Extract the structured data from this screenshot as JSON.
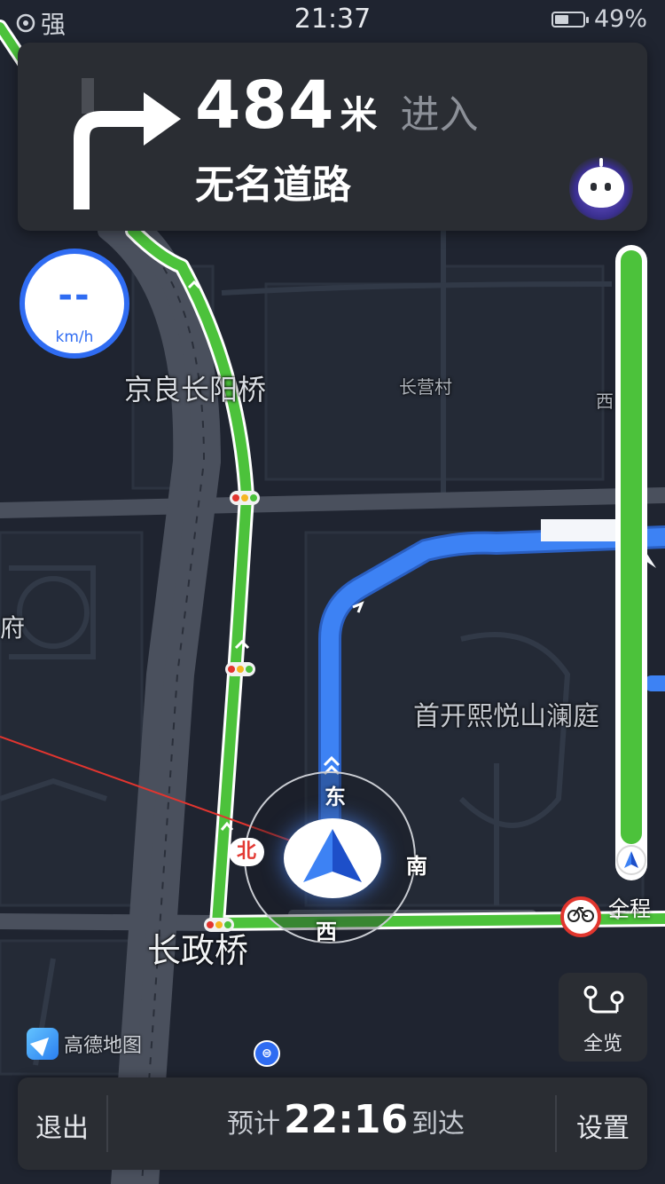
{
  "status": {
    "signal": "强",
    "time": "21:37",
    "battery": "49%",
    "battery_level": 0.49
  },
  "guidance": {
    "distance": "484",
    "unit": "米",
    "action": "进入",
    "road": "无名道路"
  },
  "speed": {
    "value": "--",
    "unit": "km/h"
  },
  "map_labels": {
    "jingliang": "京良长阳桥",
    "changying": "长营村",
    "xi_partial": "西",
    "fu_partial": "府",
    "shoukai": "首开熙悦山澜庭",
    "changzheng": "长政桥"
  },
  "compass": {
    "east": "东",
    "south": "南",
    "west": "西",
    "north": "北"
  },
  "progress": {
    "label": "全程",
    "fraction_remaining": 0.95
  },
  "overview": {
    "label": "全览"
  },
  "logo": {
    "text": "高德地图"
  },
  "metro": {
    "icon": "metro-icon"
  },
  "bottom": {
    "exit": "退出",
    "eta_prefix": "预计",
    "eta_time": "22:16",
    "eta_suffix": "到达",
    "settings": "设置"
  },
  "colors": {
    "route": "#3d82f4",
    "traveled": "#4cc23b",
    "speed_ring": "#2f6cf2",
    "card": "#2a2d33",
    "map": "#1f2430"
  }
}
